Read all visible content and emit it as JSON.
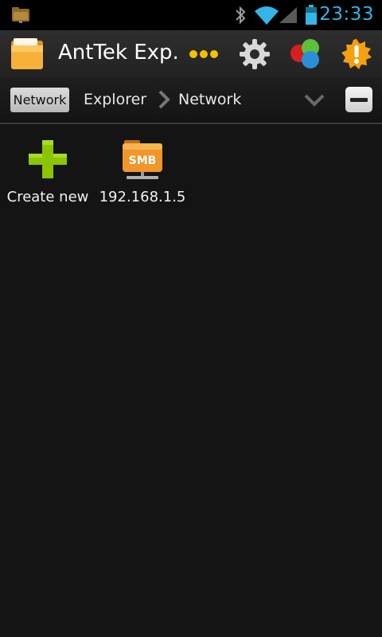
{
  "status_bar": {
    "time": "23:33",
    "accent": "#33b5e5",
    "icons": [
      "folder-notification-icon",
      "bluetooth-icon",
      "wifi-icon",
      "signal-icon",
      "battery-icon"
    ]
  },
  "action_bar": {
    "title": "AntTek Exp.",
    "icons": [
      "app-folder-icon",
      "more-dots-icon",
      "gear-icon",
      "colors-icon",
      "alert-icon"
    ]
  },
  "breadcrumb": {
    "chip_label": "Network",
    "items": [
      "Explorer",
      "Network"
    ],
    "icons": [
      "chevron-right-icon",
      "chevron-down-icon",
      "minus-icon"
    ]
  },
  "grid": {
    "items": [
      {
        "label": "Create new",
        "icon": "plus-icon",
        "icon_color": "#8bc400"
      },
      {
        "label": "192.168.1.5",
        "icon": "smb-share-icon",
        "icon_text": "SMB",
        "icon_color": "#f0962a"
      }
    ]
  }
}
